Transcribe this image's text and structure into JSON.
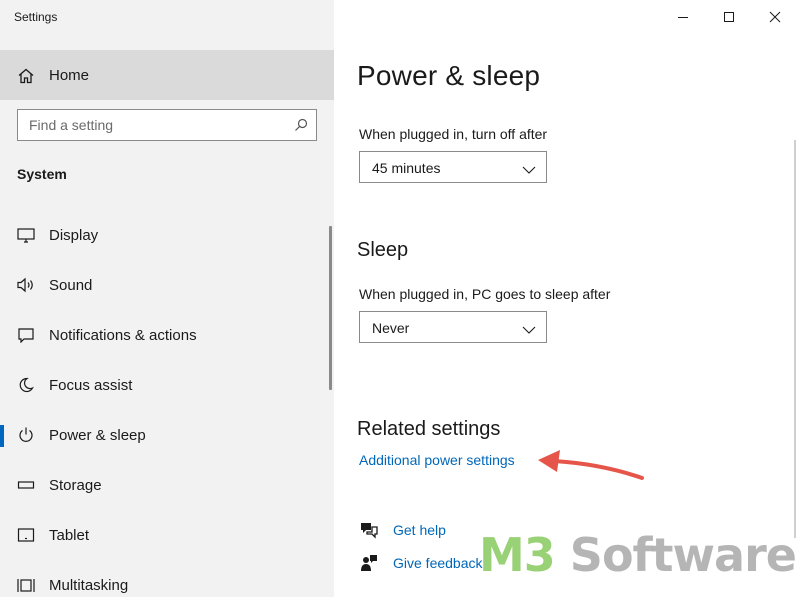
{
  "window": {
    "title": "Settings",
    "controls": {
      "minimize": "minimize-icon",
      "maximize": "maximize-icon",
      "close": "close-icon"
    }
  },
  "sidebar": {
    "home_label": "Home",
    "search": {
      "placeholder": "Find a setting",
      "value": ""
    },
    "section_label": "System",
    "items": [
      {
        "label": "Display",
        "icon": "display-icon",
        "active": false
      },
      {
        "label": "Sound",
        "icon": "speaker-icon",
        "active": false
      },
      {
        "label": "Notifications & actions",
        "icon": "notification-icon",
        "active": false
      },
      {
        "label": "Focus assist",
        "icon": "moon-icon",
        "active": false
      },
      {
        "label": "Power & sleep",
        "icon": "power-icon",
        "active": true
      },
      {
        "label": "Storage",
        "icon": "storage-icon",
        "active": false
      },
      {
        "label": "Tablet",
        "icon": "tablet-icon",
        "active": false
      },
      {
        "label": "Multitasking",
        "icon": "multitasking-icon",
        "active": false
      }
    ]
  },
  "main": {
    "page_title": "Power & sleep",
    "screen": {
      "label": "When plugged in, turn off after",
      "value": "45 minutes"
    },
    "sleep": {
      "heading": "Sleep",
      "label": "When plugged in, PC goes to sleep after",
      "value": "Never"
    },
    "related": {
      "heading": "Related settings",
      "link": "Additional power settings"
    },
    "help": {
      "get_help": "Get help",
      "give_feedback": "Give feedback"
    }
  },
  "watermark": {
    "prefix": "M3",
    "suffix": " Software"
  },
  "colors": {
    "accent": "#0067c0",
    "link": "#0067b8",
    "sidebar_bg": "#f2f2f2",
    "selected_bg": "#dadada",
    "arrow": "#e5554a"
  }
}
